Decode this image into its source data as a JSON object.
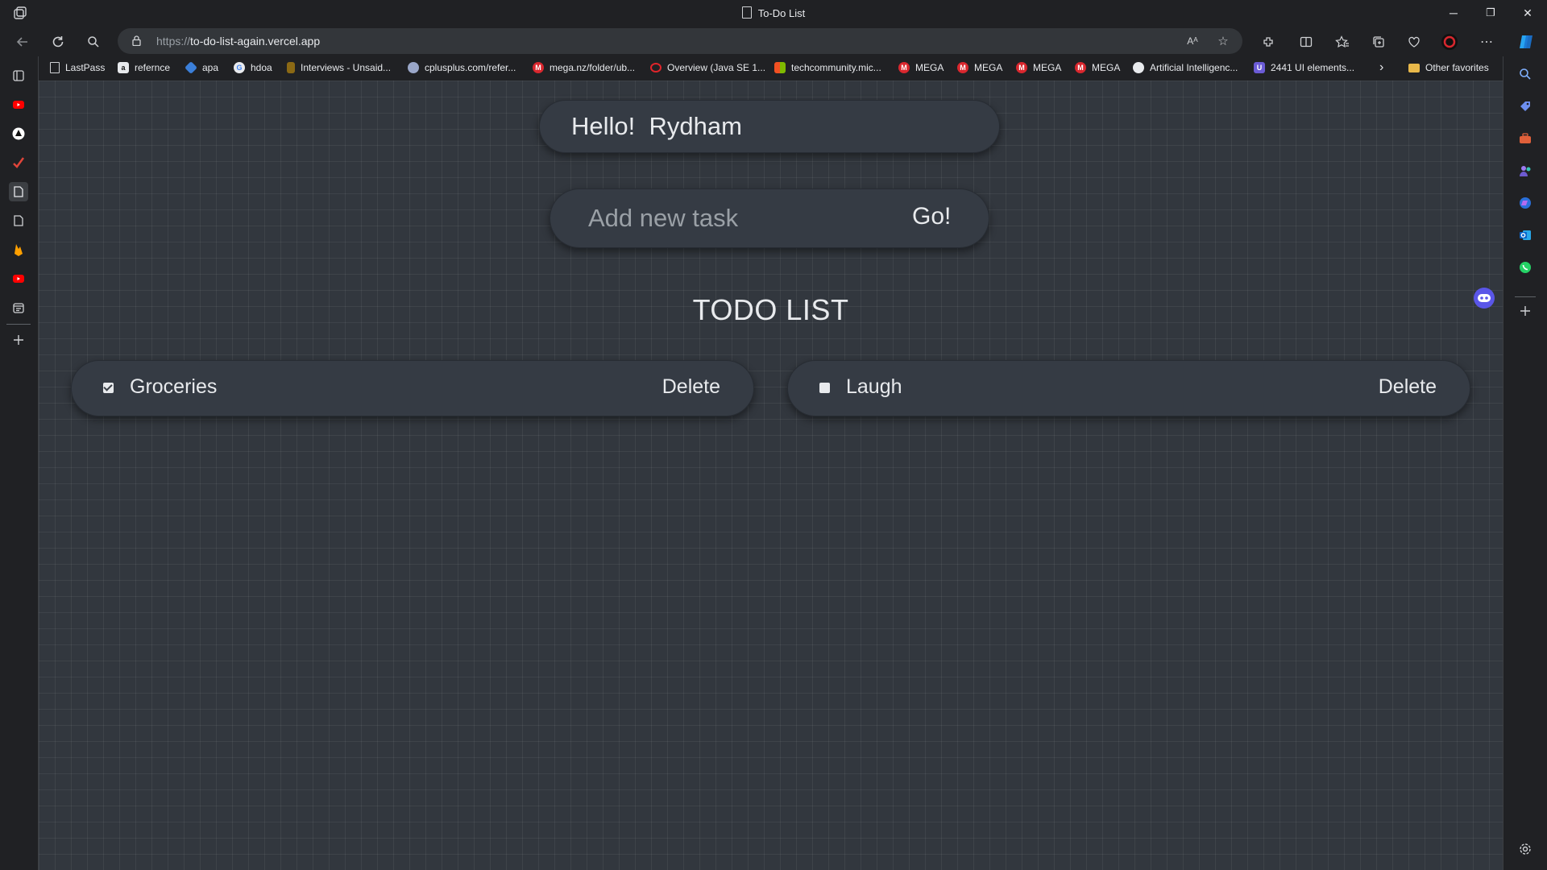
{
  "window": {
    "title": "To-Do List",
    "controls": {
      "minimize": "─",
      "restore": "❐",
      "close": "✕"
    }
  },
  "addressbar": {
    "url_protocol": "https://",
    "url_host": "to-do-list-again.vercel.app",
    "read_aloud": "Aᴬ"
  },
  "bookmarks": [
    {
      "label": "LastPass",
      "icon": "page-icon",
      "color": "#202124"
    },
    {
      "label": "refernce",
      "icon": "amazon-icon",
      "color": "#e8eaed"
    },
    {
      "label": "apa",
      "icon": "edge-icon",
      "color": "#3b7fd9"
    },
    {
      "label": "hdoa",
      "icon": "google-icon",
      "color": "#e8eaed"
    },
    {
      "label": "Interviews - Unsaid...",
      "icon": "bookmark-icon",
      "color": "#b8860b"
    },
    {
      "label": "cplusplus.com/refer...",
      "icon": "cplusplus-icon",
      "color": "#9aa7c9"
    },
    {
      "label": "mega.nz/folder/ub...",
      "icon": "mega-icon",
      "color": "#d9272e"
    },
    {
      "label": "Overview (Java SE 1...",
      "icon": "oracle-icon",
      "color": "#e0252b"
    },
    {
      "label": "techcommunity.mic...",
      "icon": "microsoft-icon",
      "color": "#f25022"
    },
    {
      "label": "MEGA",
      "icon": "mega-icon",
      "color": "#d9272e"
    },
    {
      "label": "MEGA",
      "icon": "mega-icon",
      "color": "#d9272e"
    },
    {
      "label": "MEGA",
      "icon": "mega-icon",
      "color": "#d9272e"
    },
    {
      "label": "MEGA",
      "icon": "mega-icon",
      "color": "#d9272e"
    },
    {
      "label": "Artificial Intelligenc...",
      "icon": "globe-icon",
      "color": "#e8eaed"
    },
    {
      "label": "2441 UI elements...",
      "icon": "uiverse-icon",
      "color": "#6b5bd6"
    }
  ],
  "bookmarks_more": "›",
  "other_favorites": "Other favorites",
  "app": {
    "greeting": "Hello!  Rydham",
    "task_placeholder": "Add new task",
    "task_value": "",
    "go_label": "Go!",
    "heading": "TODO LIST",
    "todos": [
      {
        "text": "Groceries",
        "done": true,
        "delete_label": "Delete"
      },
      {
        "text": "Laugh",
        "done": false,
        "delete_label": "Delete"
      }
    ]
  },
  "colors": {
    "page_bg": "#32373e",
    "card_bg": "#353b44",
    "text": "#e8eaed",
    "browser_chrome": "#202124"
  }
}
